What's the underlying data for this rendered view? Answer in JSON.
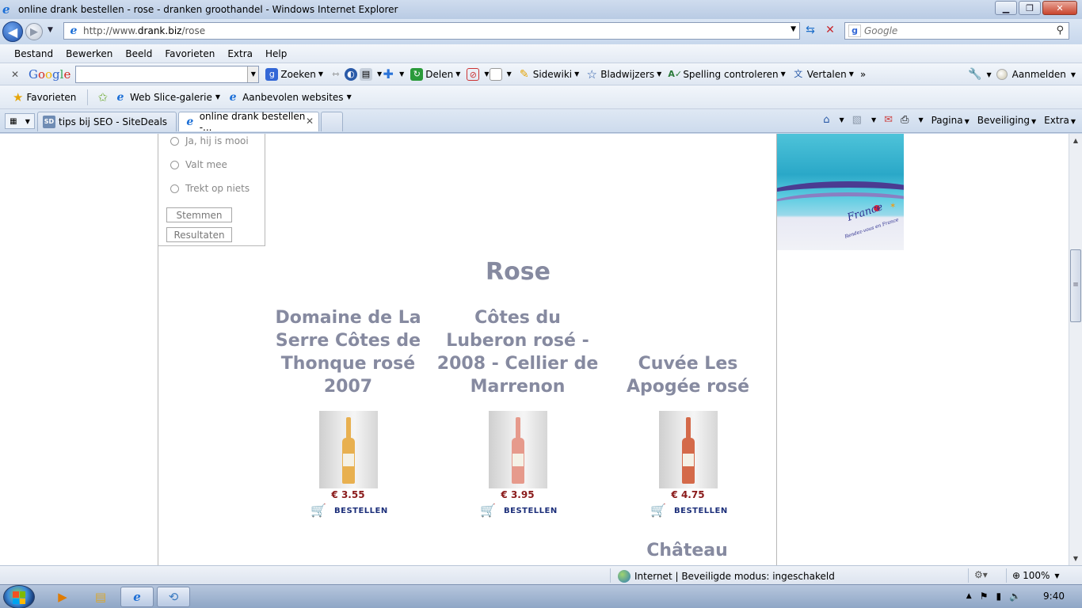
{
  "window": {
    "title": "online drank bestellen - rose - dranken groothandel - Windows Internet Explorer",
    "controls": {
      "minimize": "▁",
      "maximize": "❐",
      "close": "✕"
    }
  },
  "address": {
    "url_prefix": "http://www.",
    "url_domain": "drank.biz",
    "url_path": "/rose",
    "search_placeholder": "Google"
  },
  "menu": [
    "Bestand",
    "Bewerken",
    "Beeld",
    "Favorieten",
    "Extra",
    "Help"
  ],
  "google_toolbar": {
    "logo": [
      "G",
      "o",
      "o",
      "g",
      "l",
      "e"
    ],
    "buttons": [
      {
        "label": "Zoeken",
        "icon": "google-search-icon"
      },
      {
        "label": "Delen",
        "icon": "share-icon"
      },
      {
        "label": "Sidewiki",
        "icon": "sidewiki-icon"
      },
      {
        "label": "Bladwijzers",
        "icon": "bookmarks-star-icon"
      },
      {
        "label": "Spelling controleren",
        "icon": "spellcheck-icon"
      },
      {
        "label": "Vertalen",
        "icon": "translate-icon"
      }
    ],
    "more": "»",
    "signin": "Aanmelden"
  },
  "favorites_bar": {
    "favorites_label": "Favorieten",
    "items": [
      {
        "label": "Web Slice-galerie"
      },
      {
        "label": "Aanbevolen websites"
      }
    ]
  },
  "tabs": {
    "items": [
      {
        "label": "tips bij SEO - SiteDeals",
        "active": false
      },
      {
        "label": "online drank bestellen -...",
        "active": true
      }
    ],
    "close": "✕",
    "commands": [
      "Pagina",
      "Beveiliging",
      "Extra"
    ]
  },
  "poll": {
    "options": [
      "Ja, hij is mooi",
      "Valt mee",
      "Trekt op niets"
    ],
    "vote_button": "Stemmen",
    "results_button": "Resultaten"
  },
  "banner": {
    "brand": "France",
    "tagline": "Rendez-vous en France"
  },
  "page": {
    "title": "Rose",
    "order_label": "BESTELLEN",
    "products": [
      {
        "name": "Domaine de La Serre Côtes de Thonque rosé 2007",
        "price": "€ 3.55",
        "wine_color": "#e8b050"
      },
      {
        "name": "Côtes du Luberon rosé - 2008 - Cellier de Marrenon",
        "price": "€ 3.95",
        "wine_color": "#e69a8c"
      },
      {
        "name": "Cuvée Les Apogée rosé",
        "price": "€ 4.75",
        "wine_color": "#d46a4a"
      }
    ],
    "next_product_partial": "Château"
  },
  "status": {
    "zone": "Internet | Beveiligde modus: ingeschakeld",
    "zoom": "100%"
  },
  "taskbar": {
    "clock": "9:40"
  }
}
